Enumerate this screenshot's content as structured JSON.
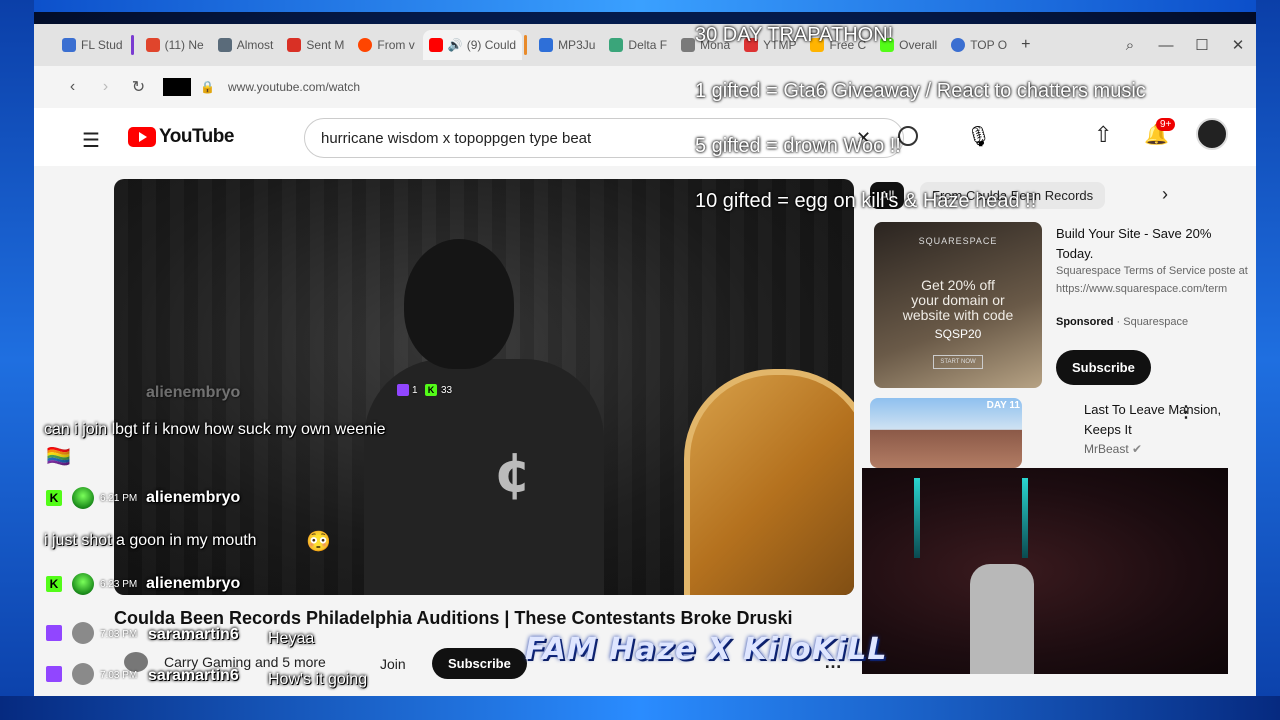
{
  "browser": {
    "tabs": [
      {
        "label": "FL Stud",
        "color": "#3b6fd1"
      },
      {
        "label": "(11) Ne",
        "color": "#e0452c"
      },
      {
        "label": "Almost",
        "color": "#5a6b7a"
      },
      {
        "label": "Sent M",
        "color": "#d93025"
      },
      {
        "label": "From v",
        "color": "#ff4500"
      },
      {
        "label": "(9) Could",
        "color": "#ff0000"
      },
      {
        "label": "MP3Ju",
        "color": "#2e6fd8"
      },
      {
        "label": "Delta F",
        "color": "#3aa57a"
      },
      {
        "label": "Mona",
        "color": "#7a7a7a"
      },
      {
        "label": "YTMP",
        "color": "#d33"
      },
      {
        "label": "Free C",
        "color": "#ffb400"
      },
      {
        "label": "Overall",
        "color": "#53fc18"
      },
      {
        "label": "TOP O",
        "color": "#3b6fd1"
      }
    ],
    "new_tab": "+",
    "url": "www.youtube.com/watch"
  },
  "youtube": {
    "logo_text": "YouTube",
    "search_value": "hurricane wisdom x topoppgen type beat",
    "notifications": "9+",
    "video_title": "Coulda Been Records Philadelphia Auditions | These Contestants Broke Druski",
    "channel_members": "Carry Gaming and 5 more",
    "join_label": "Join",
    "subscribe_label": "Subscribe",
    "chips": {
      "all": "All",
      "from": "From Coulda Been Records"
    },
    "ad": {
      "brand": "SQUARESPACE",
      "line1": "Get 20% off",
      "line2": "your domain or",
      "line3": "website with code",
      "code": "SQSP20",
      "cta_small": "START NOW",
      "title": "Build Your Site - Save 20% Today.",
      "desc": "Squarespace Terms of Service poste at https://www.squarespace.com/term",
      "sponsored": "Sponsored",
      "sponsor_name": "Squarespace",
      "subscribe": "Subscribe"
    },
    "rec": {
      "tag": "DAY 11",
      "title": "Last To Leave Mansion, Keeps It",
      "channel": "MrBeast"
    },
    "shirt_logo": "¢"
  },
  "overlay": {
    "lines": [
      "30 DAY TRAPATHON!",
      "1 gifted = Gta6 Giveaway / React to chatters music",
      "5 gifted = drown Woo  !!",
      "10 gifted = egg on kill's & Haze head  !!"
    ],
    "logo": "FAM Haze X KiloKiLL"
  },
  "viewers": {
    "twitch": "1",
    "kick": "33"
  },
  "chat": [
    {
      "user": "alienembryo",
      "time": "",
      "message": "can i join lbgt if i know how suck my own weenie",
      "emoji": "🏳️‍🌈"
    },
    {
      "user": "alienembryo",
      "time": "6:21 PM",
      "message": "i just shot a goon in my mouth",
      "emoji": "😳"
    },
    {
      "user": "alienembryo",
      "time": "6:23 PM",
      "message": "",
      "emoji": ""
    },
    {
      "user": "saramartin6",
      "time": "7:03 PM",
      "message": "Heyaa",
      "emoji": ""
    },
    {
      "user": "saramartin6",
      "time": "7:03 PM",
      "message": "How's it going",
      "emoji": ""
    }
  ]
}
